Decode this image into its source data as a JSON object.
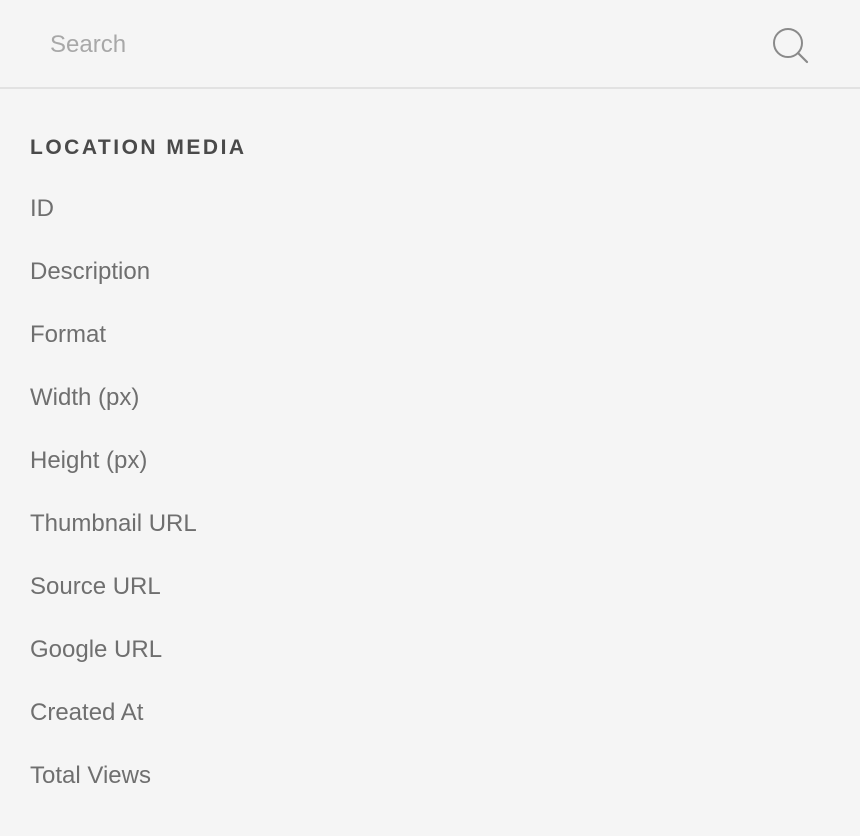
{
  "search": {
    "placeholder": "Search",
    "value": ""
  },
  "section": {
    "title": "LOCATION MEDIA",
    "fields": [
      {
        "label": "ID"
      },
      {
        "label": "Description"
      },
      {
        "label": "Format"
      },
      {
        "label": "Width (px)"
      },
      {
        "label": "Height (px)"
      },
      {
        "label": "Thumbnail URL"
      },
      {
        "label": "Source URL"
      },
      {
        "label": "Google URL"
      },
      {
        "label": "Created At"
      },
      {
        "label": "Total Views"
      }
    ]
  },
  "colors": {
    "background": "#f5f5f5",
    "divider": "#e2e2e2",
    "title_text": "#4a4a4a",
    "item_text": "#6f6f6f",
    "placeholder_text": "#a8a8a8"
  },
  "icons": {
    "search": "search-icon"
  }
}
